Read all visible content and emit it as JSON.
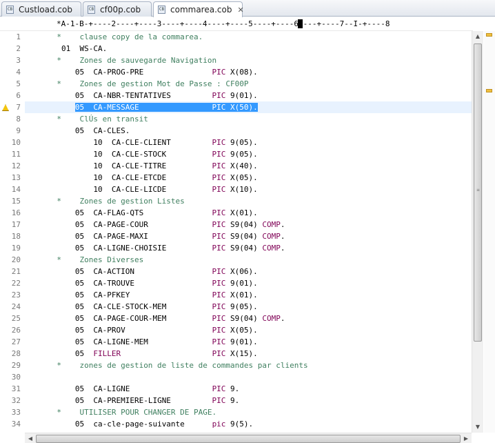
{
  "tabs": [
    {
      "label": "Custload.cob",
      "active": false,
      "file_icon": "cobol-file-icon"
    },
    {
      "label": "cf00p.cob",
      "active": false,
      "file_icon": "cobol-file-icon"
    },
    {
      "label": "commarea.cob",
      "active": true,
      "file_icon": "cobol-file-icon",
      "close_glyph": "✕"
    }
  ],
  "ruler": "*A-1-B-+----2----+----3----+----4----+----5----+----6----+----7--I-+----8",
  "warning_line": 7,
  "highlight_line": 7,
  "colors": {
    "comment": "#3f7f5f",
    "keyword": "#7f0055",
    "selection": "#3399ff",
    "current_line": "#e8f2fe"
  },
  "lines": [
    {
      "n": "1",
      "seq": "       ",
      "text": "*    clause copy de la commarea.",
      "type": "comment"
    },
    {
      "n": "2",
      "seq": "        ",
      "text": "01  WS-CA.",
      "type": "code"
    },
    {
      "n": "3",
      "seq": "       ",
      "text": "*    Zones de sauvegarde Navigation",
      "type": "comment"
    },
    {
      "n": "4",
      "seq": "           ",
      "text": "05  CA-PROG-PRE",
      "pad": "               ",
      "kw": "PIC",
      "rest": " X(08).",
      "type": "pic"
    },
    {
      "n": "5",
      "seq": "       ",
      "text": "*    Zones de gestion Mot de Passe : CF00P",
      "type": "comment"
    },
    {
      "n": "6",
      "seq": "           ",
      "text": "05  CA-NBR-TENTATIVES",
      "pad": "         ",
      "kw": "PIC",
      "rest": " 9(01).",
      "type": "pic"
    },
    {
      "n": "7",
      "seq": "           ",
      "text": "05  CA-MESSAGE",
      "pad": "                ",
      "kw": "PIC",
      "rest": " X(50).",
      "type": "selected"
    },
    {
      "n": "8",
      "seq": "       ",
      "text": "*    ClÚs en transit",
      "type": "comment"
    },
    {
      "n": "9",
      "seq": "           ",
      "text": "05  CA-CLES.",
      "type": "code"
    },
    {
      "n": "10",
      "seq": "               ",
      "text": "10  CA-CLE-CLIENT",
      "pad": "         ",
      "kw": "PIC",
      "rest": " 9(05).",
      "type": "pic"
    },
    {
      "n": "11",
      "seq": "               ",
      "text": "10  CA-CLE-STOCK",
      "pad": "          ",
      "kw": "PIC",
      "rest": " 9(05).",
      "type": "pic"
    },
    {
      "n": "12",
      "seq": "               ",
      "text": "10  CA-CLE-TITRE",
      "pad": "          ",
      "kw": "PIC",
      "rest": " X(40).",
      "type": "pic"
    },
    {
      "n": "13",
      "seq": "               ",
      "text": "10  CA-CLE-ETCDE",
      "pad": "          ",
      "kw": "PIC",
      "rest": " X(05).",
      "type": "pic"
    },
    {
      "n": "14",
      "seq": "               ",
      "text": "10  CA-CLE-LICDE",
      "pad": "          ",
      "kw": "PIC",
      "rest": " X(10).",
      "type": "pic"
    },
    {
      "n": "15",
      "seq": "       ",
      "text": "*    Zones de gestion Listes",
      "type": "comment"
    },
    {
      "n": "16",
      "seq": "           ",
      "text": "05  CA-FLAG-QTS",
      "pad": "               ",
      "kw": "PIC",
      "rest": " X(01).",
      "type": "pic"
    },
    {
      "n": "17",
      "seq": "           ",
      "text": "05  CA-PAGE-COUR",
      "pad": "              ",
      "kw": "PIC",
      "rest": " S9(04) ",
      "kw2": "COMP",
      "rest2": ".",
      "type": "pic2"
    },
    {
      "n": "18",
      "seq": "           ",
      "text": "05  CA-PAGE-MAXI",
      "pad": "              ",
      "kw": "PIC",
      "rest": " S9(04) ",
      "kw2": "COMP",
      "rest2": ".",
      "type": "pic2"
    },
    {
      "n": "19",
      "seq": "           ",
      "text": "05  CA-LIGNE-CHOISIE",
      "pad": "          ",
      "kw": "PIC",
      "rest": " S9(04) ",
      "kw2": "COMP",
      "rest2": ".",
      "type": "pic2"
    },
    {
      "n": "20",
      "seq": "       ",
      "text": "*    Zones Diverses",
      "type": "comment"
    },
    {
      "n": "21",
      "seq": "           ",
      "text": "05  CA-ACTION",
      "pad": "                 ",
      "kw": "PIC",
      "rest": " X(06).",
      "type": "pic"
    },
    {
      "n": "22",
      "seq": "           ",
      "text": "05  CA-TROUVE",
      "pad": "                 ",
      "kw": "PIC",
      "rest": " 9(01).",
      "type": "pic"
    },
    {
      "n": "23",
      "seq": "           ",
      "text": "05  CA-PFKEY",
      "pad": "                  ",
      "kw": "PIC",
      "rest": " X(01).",
      "type": "pic"
    },
    {
      "n": "24",
      "seq": "           ",
      "text": "05  CA-CLE-STOCK-MEM",
      "pad": "          ",
      "kw": "PIC",
      "rest": " 9(05).",
      "type": "pic"
    },
    {
      "n": "25",
      "seq": "           ",
      "text": "05  CA-PAGE-COUR-MEM",
      "pad": "          ",
      "kw": "PIC",
      "rest": " S9(04) ",
      "kw2": "COMP",
      "rest2": ".",
      "type": "pic2"
    },
    {
      "n": "26",
      "seq": "           ",
      "text": "05  CA-PROV",
      "pad": "                   ",
      "kw": "PIC",
      "rest": " X(05).",
      "type": "pic"
    },
    {
      "n": "27",
      "seq": "           ",
      "text": "05  CA-LIGNE-MEM",
      "pad": "              ",
      "kw": "PIC",
      "rest": " 9(01).",
      "type": "pic"
    },
    {
      "n": "28",
      "seq": "           ",
      "text": "05  ",
      "kwlead": "FILLER",
      "pad": "                    ",
      "kw": "PIC",
      "rest": " X(15).",
      "type": "filler"
    },
    {
      "n": "29",
      "seq": "       ",
      "text": "*    zones de gestion de liste de commandes par clients",
      "type": "comment"
    },
    {
      "n": "30",
      "seq": "",
      "text": "",
      "type": "code"
    },
    {
      "n": "31",
      "seq": "           ",
      "text": "05  CA-LIGNE",
      "pad": "                  ",
      "kw": "PIC",
      "rest": " 9.",
      "type": "pic"
    },
    {
      "n": "32",
      "seq": "           ",
      "text": "05  CA-PREMIERE-LIGNE",
      "pad": "         ",
      "kw": "PIC",
      "rest": " 9.",
      "type": "pic"
    },
    {
      "n": "33",
      "seq": "       ",
      "text": "*    UTILISER POUR CHANGER DE PAGE.",
      "type": "comment"
    },
    {
      "n": "34",
      "seq": "           ",
      "text": "05  ca-cle-page-suivante",
      "pad": "      ",
      "kw": "pic",
      "rest": " 9(5).",
      "type": "pic"
    }
  ]
}
